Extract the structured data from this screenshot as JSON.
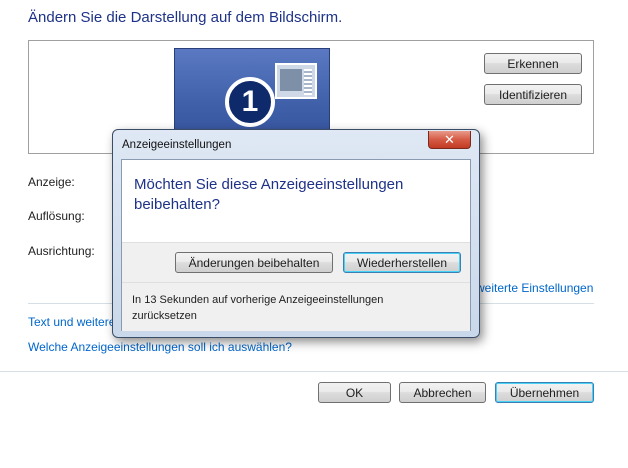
{
  "page": {
    "title": "Ändern Sie die Darstellung auf dem Bildschirm."
  },
  "monitor_area": {
    "monitor_number": "1",
    "detect_button": "Erkennen",
    "identify_button": "Identifizieren"
  },
  "settings": {
    "display_label": "Anzeige:",
    "resolution_label": "Auflösung:",
    "orientation_label": "Ausrichtung:",
    "advanced_link": "weiterte Einstellungen"
  },
  "links": {
    "text_size_link": "Text und weitere",
    "which_settings_link": "Welche Anzeigeeinstellungen soll ich auswählen?"
  },
  "footer": {
    "ok_button": "OK",
    "cancel_button": "Abbrechen",
    "apply_button": "Übernehmen"
  },
  "dialog": {
    "title": "Anzeigeeinstellungen",
    "close_glyph": "✕",
    "question": "Möchten Sie diese Anzeigeeinstellungen beibehalten?",
    "keep_button": "Änderungen beibehalten",
    "revert_button": "Wiederherstellen",
    "countdown_text": "In 13 Sekunden auf vorherige Anzeigeeinstellungen zurücksetzen"
  }
}
